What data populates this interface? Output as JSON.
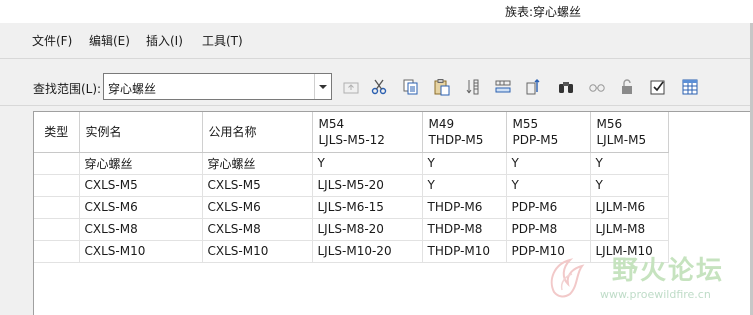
{
  "window": {
    "title": "族表:穿心螺丝"
  },
  "menu": {
    "file": "文件(F)",
    "edit": "编辑(E)",
    "insert": "插入(I)",
    "tools": "工具(T)"
  },
  "toolbar": {
    "scope_label": "查找范围(L):",
    "scope_value": "穿心螺丝"
  },
  "table": {
    "headers": {
      "type": "类型",
      "instance": "实例名",
      "common": "公用名称",
      "m54": [
        "M54",
        "LJLS-M5-12"
      ],
      "m49": [
        "M49",
        "THDP-M5"
      ],
      "m55": [
        "M55",
        "PDP-M5"
      ],
      "m56": [
        "M56",
        "LJLM-M5"
      ]
    },
    "rows": [
      [
        "",
        "穿心螺丝",
        "穿心螺丝",
        "Y",
        "Y",
        "Y",
        "Y"
      ],
      [
        "",
        "CXLS-M5",
        "CXLS-M5",
        "LJLS-M5-20",
        "Y",
        "Y",
        "Y"
      ],
      [
        "",
        "CXLS-M6",
        "CXLS-M6",
        "LJLS-M6-15",
        "THDP-M6",
        "PDP-M6",
        "LJLM-M6"
      ],
      [
        "",
        "CXLS-M8",
        "CXLS-M8",
        "LJLS-M8-20",
        "THDP-M8",
        "PDP-M8",
        "LJLM-M8"
      ],
      [
        "",
        "CXLS-M10",
        "CXLS-M10",
        "LJLS-M10-20",
        "THDP-M10",
        "PDP-M10",
        "LJLM-M10"
      ]
    ]
  },
  "watermark": {
    "name": "野火论坛",
    "url": "www.proewildfire.cn"
  },
  "icons": [
    "folder-up-icon",
    "scissors-icon",
    "copy-icon",
    "paste-icon",
    "insert-column-icon",
    "insert-row-icon",
    "insert-item-icon",
    "binoculars-icon",
    "glasses-icon",
    "lock-icon",
    "checkbox-icon",
    "table-icon"
  ]
}
